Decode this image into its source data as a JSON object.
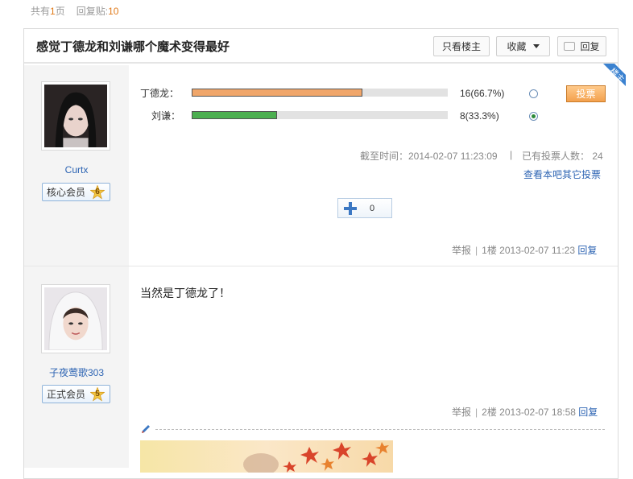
{
  "pager": {
    "total_prefix": "共有",
    "total_pages": "1",
    "total_suffix": "页",
    "replies_label": "回复贴:",
    "replies_count": "10"
  },
  "thread": {
    "title": "感觉丁德龙和刘谦哪个魔术变得最好",
    "only_author_label": "只看楼主",
    "favorite_label": "收藏",
    "reply_label": "回复",
    "louzhu_tag": "楼主"
  },
  "posts": [
    {
      "username": "Curtx",
      "rank_label": "核心会员",
      "rank_level": "6",
      "poll": {
        "options": [
          {
            "name": "丁德龙：",
            "count_text": "16(66.7%)",
            "percent": 66.7,
            "selected": false,
            "color": "#f0a66a"
          },
          {
            "name": "刘谦：",
            "count_text": "8(33.3%)",
            "percent": 33.3,
            "selected": true,
            "color": "#4caf50"
          }
        ],
        "vote_button": "投票",
        "deadline_text": "截至时间：2014-02-07 11:23:09",
        "voters_text": "已有投票人数： 24",
        "other_polls_link": "查看本吧其它投票",
        "plus_count": "0"
      },
      "footer": {
        "report": "举报",
        "floor": "1楼",
        "time": "2013-02-07 11:23",
        "reply": "回复"
      }
    },
    {
      "username": "子夜莺歌303",
      "rank_label": "正式会员",
      "rank_level": "5",
      "content": "当然是丁德龙了！",
      "footer": {
        "report": "举报",
        "floor": "2楼",
        "time": "2013-02-07 18:58",
        "reply": "回复"
      }
    }
  ],
  "colors": {
    "link": "#2d64b3",
    "vote_button": "#f3a14d",
    "louzhu_tag": "#3b82d0"
  }
}
